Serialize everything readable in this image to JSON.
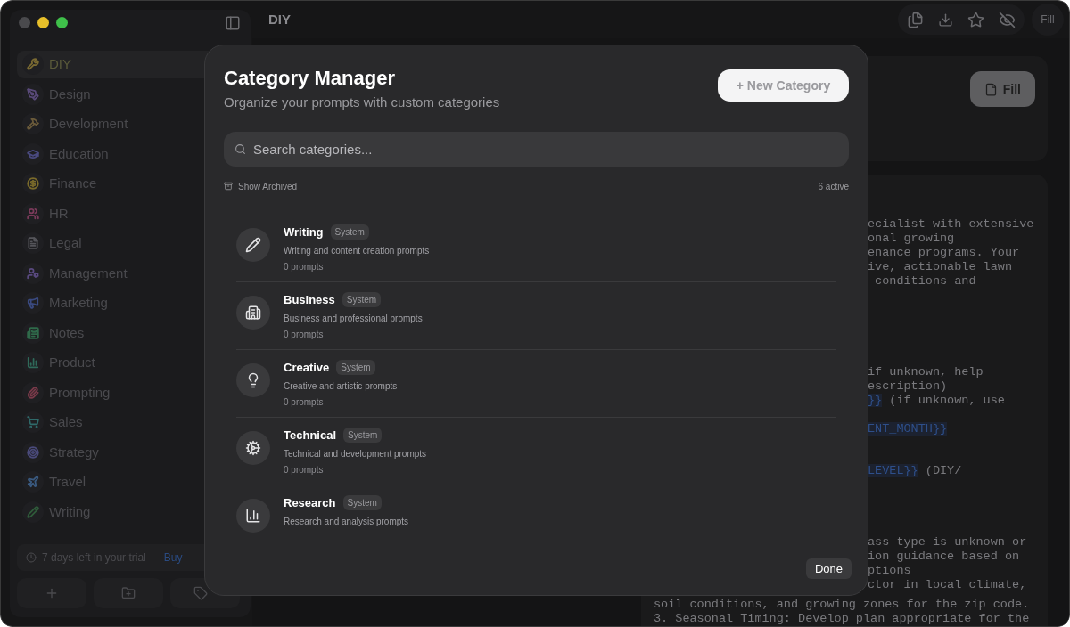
{
  "window": {
    "title": "DIY"
  },
  "sidebar": {
    "items": [
      {
        "label": "DIY",
        "selected": true,
        "color": "#7a6a32"
      },
      {
        "label": "Design",
        "selected": false,
        "color": "#5a4a7a"
      },
      {
        "label": "Development",
        "selected": false,
        "color": "#6a5a3a"
      },
      {
        "label": "Education",
        "selected": false,
        "color": "#4a4a80"
      },
      {
        "label": "Finance",
        "selected": false,
        "color": "#7a6a2a"
      },
      {
        "label": "HR",
        "selected": false,
        "color": "#7a3a5a"
      },
      {
        "label": "Legal",
        "selected": false,
        "color": "#55555a"
      },
      {
        "label": "Management",
        "selected": false,
        "color": "#5a4a80"
      },
      {
        "label": "Marketing",
        "selected": false,
        "color": "#3a4a80"
      },
      {
        "label": "Notes",
        "selected": false,
        "color": "#2f6a4a"
      },
      {
        "label": "Product",
        "selected": false,
        "color": "#2f6a5a"
      },
      {
        "label": "Prompting",
        "selected": false,
        "color": "#7a3a4a"
      },
      {
        "label": "Sales",
        "selected": false,
        "color": "#2f6a6a"
      },
      {
        "label": "Strategy",
        "selected": false,
        "color": "#4a4a7a"
      },
      {
        "label": "Travel",
        "selected": false,
        "color": "#3a5a80"
      },
      {
        "label": "Writing",
        "selected": false,
        "color": "#2f5a3a"
      }
    ],
    "trial": {
      "text": "7 days left in your trial",
      "link": "Buy"
    }
  },
  "toolbar": {
    "fill_label": "Fill"
  },
  "fill_button": {
    "label": "Fill"
  },
  "prompt_text": {
    "groups": [
      [
        [
          {
            "kind": "text",
            "text": "ecialist with extensive"
          }
        ],
        [
          {
            "kind": "text",
            "text": "onal growing"
          }
        ],
        [
          {
            "kind": "text",
            "text": "enance programs. Your"
          }
        ],
        [
          {
            "kind": "text",
            "text": "ive, actionable lawn"
          }
        ],
        [
          {
            "kind": "text",
            "text": " conditions and"
          }
        ]
      ],
      [
        [
          {
            "kind": "text",
            "text": "if unknown, help"
          }
        ],
        [
          {
            "kind": "text",
            "text": "escription)"
          }
        ],
        [
          {
            "kind": "variable",
            "text": "}}"
          },
          {
            "kind": "text",
            "text": " (if unknown, use"
          }
        ]
      ],
      [
        [
          {
            "kind": "variable",
            "text": "ENT_MONTH}}"
          }
        ]
      ],
      [
        [
          {
            "kind": "variable",
            "text": "LEVEL}}"
          },
          {
            "kind": "text",
            "text": " (DIY/"
          }
        ]
      ],
      [
        [
          {
            "kind": "text",
            "text": "ass type is unknown or"
          }
        ],
        [
          {
            "kind": "text",
            "text": "ion guidance based on"
          }
        ],
        [
          {
            "kind": "text",
            "text": "ptions"
          }
        ],
        [
          {
            "kind": "text",
            "text": "ctor in local climate,"
          }
        ]
      ]
    ],
    "tail": [
      "soil conditions, and growing zones for the zip code.",
      "3. Seasonal Timing: Develop plan appropriate for the"
    ]
  },
  "modal": {
    "title": "Category Manager",
    "subtitle": "Organize your prompts with custom categories",
    "new_button": "+ New Category",
    "search": {
      "placeholder": "Search categories..."
    },
    "show_archived": "Show Archived",
    "active_count": "6 active",
    "categories": [
      {
        "name": "Writing",
        "badge": "System",
        "description": "Writing and content creation prompts",
        "count": "0 prompts"
      },
      {
        "name": "Business",
        "badge": "System",
        "description": "Business and professional prompts",
        "count": "0 prompts"
      },
      {
        "name": "Creative",
        "badge": "System",
        "description": "Creative and artistic prompts",
        "count": "0 prompts"
      },
      {
        "name": "Technical",
        "badge": "System",
        "description": "Technical and development prompts",
        "count": "0 prompts"
      },
      {
        "name": "Research",
        "badge": "System",
        "description": "Research and analysis prompts"
      }
    ],
    "done": "Done"
  }
}
